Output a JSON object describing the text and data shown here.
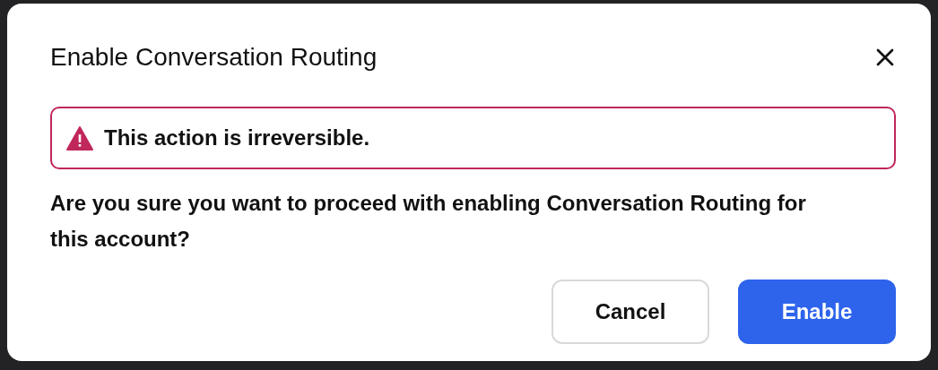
{
  "dialog": {
    "title": "Enable Conversation Routing",
    "alert": {
      "kind": "warning",
      "text": "This action is irreversible."
    },
    "message": "Are you sure you want to proceed with enabling Conversation Routing for this account?",
    "buttons": [
      {
        "label": "Cancel",
        "kind": "secondary"
      },
      {
        "label": "Enable",
        "kind": "primary"
      }
    ]
  }
}
